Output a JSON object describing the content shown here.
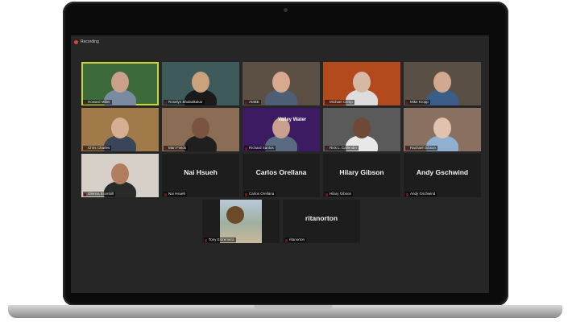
{
  "recording": {
    "label": "Recording"
  },
  "participants": [
    {
      "name": "Howard Miller",
      "video": true,
      "bg": "#3d6a3a",
      "skin": "#c9a08a",
      "shirt": "#7a8aa0",
      "active": true
    },
    {
      "name": "Roselyn Bhabalkakar",
      "video": true,
      "bg": "#3f5a5a",
      "skin": "#caa37e",
      "shirt": "#1a1a1a"
    },
    {
      "name": "AMBE",
      "video": true,
      "bg": "#5c5045",
      "skin": "#d7a98f",
      "shirt": "#4e5e75"
    },
    {
      "name": "Michael Crimp",
      "video": true,
      "bg": "#b24a1e",
      "skin": "#d6b8a5",
      "shirt": "#dddddd"
    },
    {
      "name": "Mike Kropp",
      "video": true,
      "bg": "#5a4f44",
      "skin": "#d1a890",
      "shirt": "#3b5d8a"
    },
    {
      "name": "Chris Charles",
      "video": true,
      "bg": "#a07a48",
      "skin": "#d6ae92",
      "shirt": "#3a4658"
    },
    {
      "name": "Mari Fields",
      "video": true,
      "bg": "#8b6c54",
      "skin": "#7a5440",
      "shirt": "#1f1f1f"
    },
    {
      "name": "Richard Santos",
      "video": true,
      "bg": "#3c1b62",
      "skin": "#c9a08d",
      "shirt": "#5a6a80",
      "overlay": "Valley Water"
    },
    {
      "name": "Rick L. Callender",
      "video": true,
      "bg": "#5a5a5a",
      "skin": "#6e4a36",
      "shirt": "#e8e8e8"
    },
    {
      "name": "Rachael Gibson",
      "video": true,
      "bg": "#8a7060",
      "skin": "#e0c2ae",
      "shirt": "#8fb0d0"
    },
    {
      "name": "Glenna Brambill",
      "video": true,
      "bg": "#d7d0c8",
      "skin": "#b17f60",
      "shirt": "#2a2a2a"
    },
    {
      "name": "Nai Hsueh",
      "video": false,
      "display": "Nai Hsueh"
    },
    {
      "name": "Carlos Orellana",
      "video": false,
      "display": "Carlos Orellana"
    },
    {
      "name": "Hilary Gibson",
      "video": false,
      "display": "Hilary Gibson"
    },
    {
      "name": "Andy Gschwind",
      "video": false,
      "display": "Andy Gschwind"
    },
    {
      "name": "Tony Estremera",
      "video": true,
      "bg": "#8aa0b8",
      "skin": "#b36b3c",
      "shirt": "#6a7a4a",
      "scene": "house"
    },
    {
      "name": "ritanorton",
      "video": false,
      "display": "ritanorton"
    }
  ]
}
